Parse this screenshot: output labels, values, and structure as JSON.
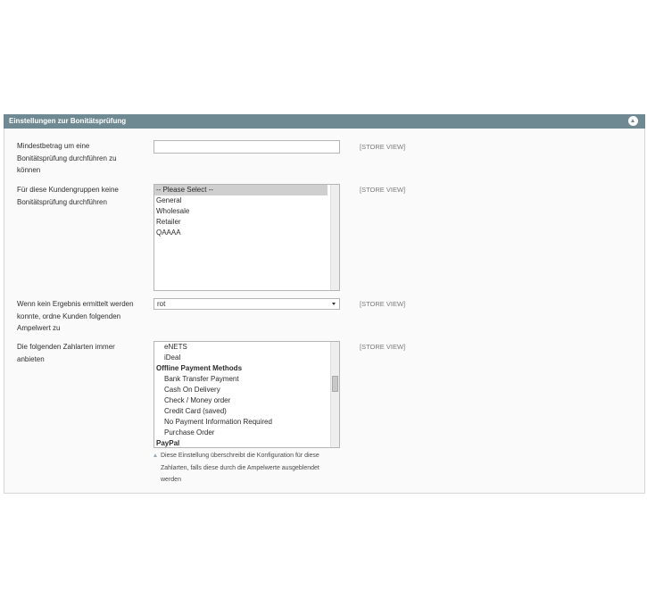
{
  "section": {
    "title": "Einstellungen zur Bonitätsprüfung"
  },
  "rows": {
    "min_amount": {
      "label": "Mindestbetrag um eine Bonitätsprüfung durchführen zu können",
      "value": "",
      "scope": "[STORE VIEW]"
    },
    "customer_groups": {
      "label": "Für diese Kundengruppen keine Bonitätsprüfung durchführen",
      "scope": "[STORE VIEW]",
      "options": [
        "-- Please Select --",
        "General",
        "Wholesale",
        "Retailer",
        "QAAAA"
      ]
    },
    "traffic_light": {
      "label": "Wenn kein Ergebnis ermittelt werden konnte, ordne Kunden folgenden Ampelwert zu",
      "value": "rot",
      "scope": "[STORE VIEW]"
    },
    "payment_methods": {
      "label": "Die folgenden Zahlarten immer anbieten",
      "scope": "[STORE VIEW]",
      "options": [
        "eNETS",
        "iDeal",
        "Offline Payment Methods",
        "Bank Transfer Payment",
        "Cash On Delivery",
        "Check / Money order",
        "Credit Card (saved)",
        "No Payment Information Required",
        "Purchase Order",
        "PayPal"
      ],
      "note": "Diese Einstellung überschreibt die Konfiguration für diese Zahlarten, falls diese durch die Ampelwerte ausgeblendet werden"
    }
  },
  "icons": {
    "collapse": "collapse-up-icon",
    "select_arrow": "chevron-down-icon",
    "note": "note-arrow-icon"
  },
  "colors": {
    "header": "#6f8992",
    "panel": "#fafafa",
    "selected_option": "#cfcfcf"
  }
}
